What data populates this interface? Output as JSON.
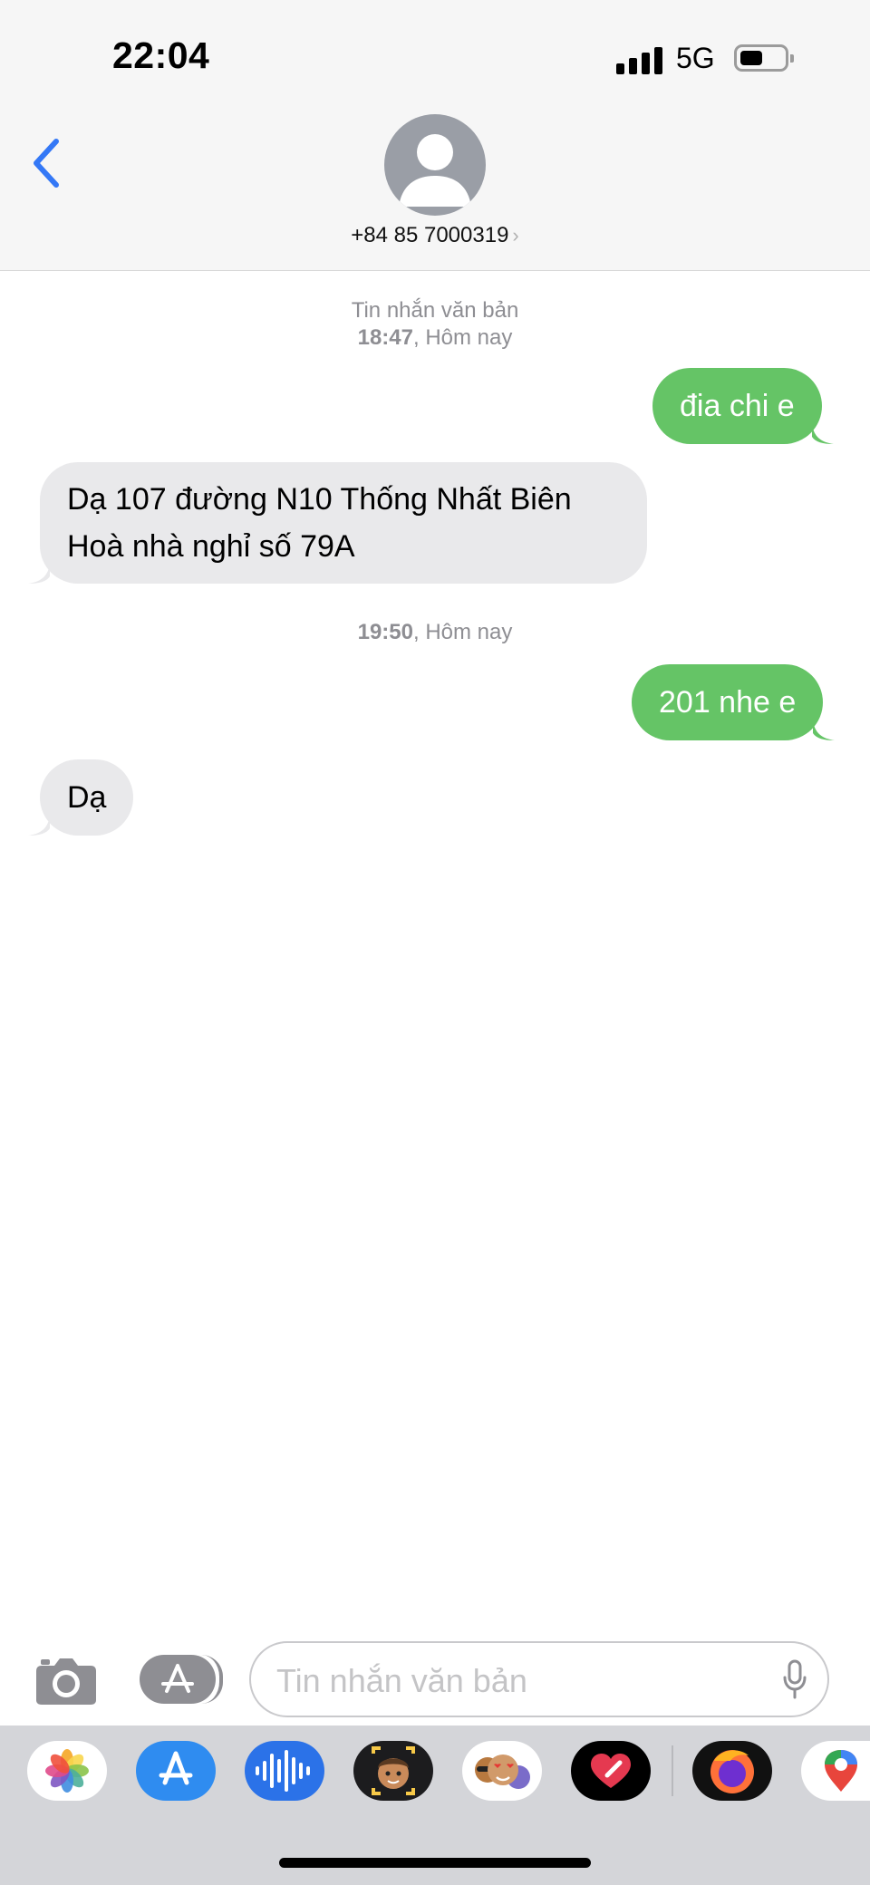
{
  "status_bar": {
    "time": "22:04",
    "network": "5G",
    "battery_percent": 40
  },
  "header": {
    "back_label": "Back",
    "contact": "+84 85 7000319",
    "contact_chevron": "›"
  },
  "thread": {
    "stamp1_type": "Tin nhắn văn bản",
    "stamp1_time": "18:47",
    "stamp1_day": ", Hôm nay",
    "msg1": "đia chi e",
    "msg2_line1": "Dạ 107 đường N10 Thống Nhất Biên",
    "msg2_line2": "Hoà nhà nghỉ số 79A",
    "stamp2_time": "19:50",
    "stamp2_day": ", Hôm nay",
    "msg3": "201 nhe e",
    "msg4": "Dạ"
  },
  "input": {
    "placeholder": "Tin nhắn văn bản",
    "value": ""
  },
  "drawer": {
    "apps": [
      "photos-icon",
      "app-store-icon",
      "audio-message-icon",
      "memoji-icon",
      "memoji-stickers-icon",
      "digital-touch-icon",
      "firefox-icon",
      "maps-icon"
    ]
  },
  "colors": {
    "outgoing": "#65c466",
    "incoming": "#e9e9eb",
    "accent": "#3478f6"
  }
}
